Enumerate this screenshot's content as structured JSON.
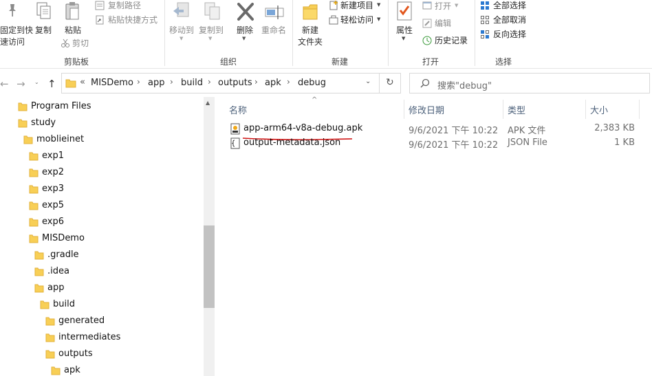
{
  "ribbon": {
    "clipboard": {
      "pin_label_1": "固定到快",
      "pin_label_2": "速访问",
      "copy": "复制",
      "paste": "粘贴",
      "copy_path": "复制路径",
      "paste_shortcut": "粘贴快捷方式",
      "cut": "剪切",
      "group": "剪贴板"
    },
    "organize": {
      "move_to": "移动到",
      "copy_to": "复制到",
      "delete": "删除",
      "rename": "重命名",
      "group": "组织"
    },
    "new": {
      "new_folder_1": "新建",
      "new_folder_2": "文件夹",
      "new_item": "新建项目",
      "easy_access": "轻松访问",
      "group": "新建"
    },
    "open": {
      "properties": "属性",
      "open": "打开",
      "edit": "编辑",
      "history": "历史记录",
      "group": "打开"
    },
    "select": {
      "select_all": "全部选择",
      "select_none": "全部取消",
      "invert": "反向选择",
      "group": "选择"
    }
  },
  "address": {
    "overflow": "«",
    "crumbs": [
      "MISDemo",
      "app",
      "build",
      "outputs",
      "apk",
      "debug"
    ],
    "search_placeholder": "搜索\"debug\""
  },
  "tree": {
    "items": [
      "Program Files",
      "study",
      "moblieinet",
      "exp1",
      "exp2",
      "exp3",
      "exp5",
      "exp6",
      "MISDemo",
      ".gradle",
      ".idea",
      "app",
      "build",
      "generated",
      "intermediates",
      "outputs",
      "apk"
    ]
  },
  "list": {
    "columns": {
      "name": "名称",
      "modified": "修改日期",
      "type": "类型",
      "size": "大小"
    },
    "files": [
      {
        "name": "app-arm64-v8a-debug.apk",
        "modified": "9/6/2021 下午 10:22",
        "type": "APK 文件",
        "size": "2,383 KB"
      },
      {
        "name": "output-metadata.json",
        "modified": "9/6/2021 下午 10:22",
        "type": "JSON File",
        "size": "1 KB"
      }
    ]
  },
  "colors": {
    "folder": "#f8cf56",
    "folder_dark": "#e2b13a",
    "annotation": "#d01414",
    "header_text": "#4c607a",
    "ribbon_blue": "#2b79d0"
  }
}
